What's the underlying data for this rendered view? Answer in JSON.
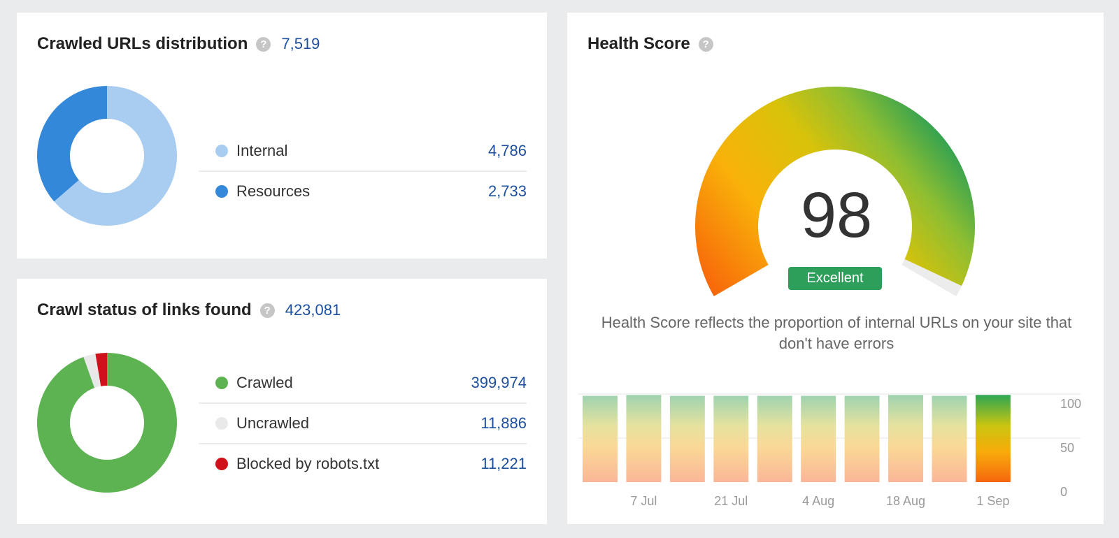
{
  "crawled_urls": {
    "title": "Crawled URLs distribution",
    "help_icon": "question-circle-icon",
    "total": "7,519",
    "items": [
      {
        "label": "Internal",
        "value": "4,786",
        "count": 4786,
        "color": "#a9cdf0"
      },
      {
        "label": "Resources",
        "value": "2,733",
        "count": 2733,
        "color": "#3388d9"
      }
    ]
  },
  "crawl_status": {
    "title": "Crawl status of links found",
    "help_icon": "question-circle-icon",
    "total": "423,081",
    "items": [
      {
        "label": "Crawled",
        "value": "399,974",
        "count": 399974,
        "color": "#5db352"
      },
      {
        "label": "Uncrawled",
        "value": "11,886",
        "count": 11886,
        "color": "#e9e9e9"
      },
      {
        "label": "Blocked by robots.txt",
        "value": "11,221",
        "count": 11221,
        "color": "#d0111b"
      }
    ]
  },
  "health_score": {
    "title": "Health Score",
    "help_icon": "question-circle-icon",
    "score": "98",
    "score_value": 98,
    "rating": "Excellent",
    "rating_color": "#2e9e5b",
    "description": "Health Score reflects the proportion of internal URLs on your site that don't have errors",
    "chart_data": {
      "type": "bar",
      "x_labels": [
        "7 Jul",
        "21 Jul",
        "4 Aug",
        "18 Aug",
        "1 Sep"
      ],
      "values": [
        98,
        99,
        98,
        98,
        98,
        98,
        98,
        99,
        98,
        99
      ],
      "highlighted_index": 9,
      "y_ticks": [
        "100",
        "50",
        "0"
      ],
      "ylim": [
        0,
        100
      ],
      "grid": true
    }
  }
}
